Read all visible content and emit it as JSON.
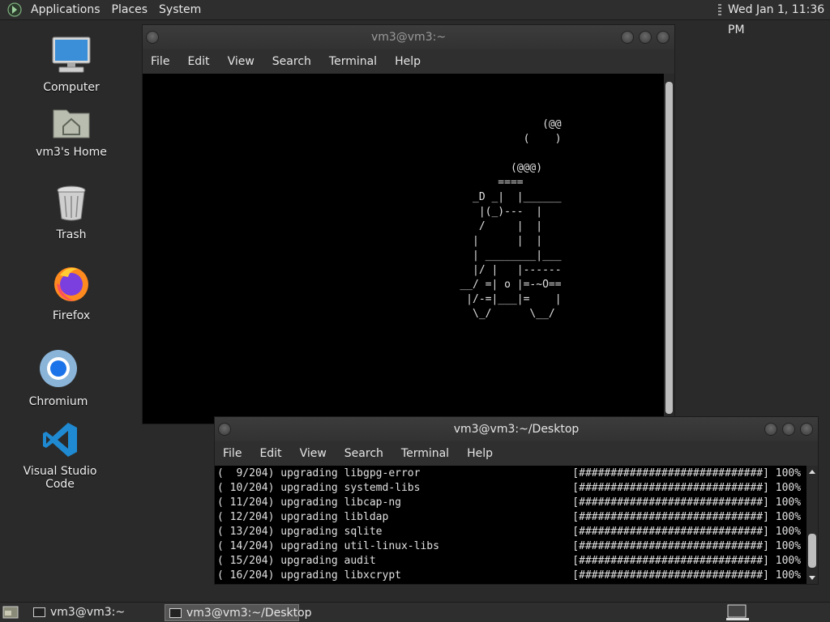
{
  "top_panel": {
    "menus": [
      "Applications",
      "Places",
      "System"
    ],
    "clock": "Wed Jan  1, 11:36 PM"
  },
  "desktop": {
    "icons": [
      {
        "label": "Computer",
        "icon": "computer-icon"
      },
      {
        "label": "vm3's Home",
        "icon": "home-folder-icon"
      },
      {
        "label": "Trash",
        "icon": "trash-icon"
      },
      {
        "label": "Firefox",
        "icon": "firefox-icon"
      },
      {
        "label": "Chromium",
        "icon": "chromium-icon"
      },
      {
        "label": "Visual Studio Code",
        "icon": "vscode-icon"
      }
    ]
  },
  "window1": {
    "title": "vm3@vm3:~",
    "menus": [
      "File",
      "Edit",
      "View",
      "Search",
      "Terminal",
      "Help"
    ],
    "terminal_lines": [
      "",
      "",
      "",
      "                                                               (@@",
      "                                                            (    )",
      "",
      "                                                          (@@@)",
      "                                                        ====",
      "                                                    _D _|  |______",
      "                                                     |(_)---  |",
      "                                                     /     |  |",
      "                                                    |      |  |",
      "                                                    | ________|___",
      "                                                    |/ |   |------",
      "                                                  __/ =| o |=-~O==",
      "                                                   |/-=|___|=    |",
      "                                                    \\_/      \\__/"
    ]
  },
  "window2": {
    "title": "vm3@vm3:~/Desktop",
    "menus": [
      "File",
      "Edit",
      "View",
      "Search",
      "Terminal",
      "Help"
    ],
    "terminal_lines": [
      "(  9/204) upgrading libgpg-error                        [#############################] 100%",
      "( 10/204) upgrading systemd-libs                        [#############################] 100%",
      "( 11/204) upgrading libcap-ng                           [#############################] 100%",
      "( 12/204) upgrading libldap                             [#############################] 100%",
      "( 13/204) upgrading sqlite                              [#############################] 100%",
      "( 14/204) upgrading util-linux-libs                     [#############################] 100%",
      "( 15/204) upgrading audit                               [#############################] 100%",
      "( 16/204) upgrading libxcrypt                           [#############################] 100%"
    ]
  },
  "bottom_panel": {
    "tasks": [
      "vm3@vm3:~",
      "vm3@vm3:~/Desktop"
    ]
  },
  "colors": {
    "accent": "#3aa8e0",
    "terminal_bg": "#000000"
  }
}
